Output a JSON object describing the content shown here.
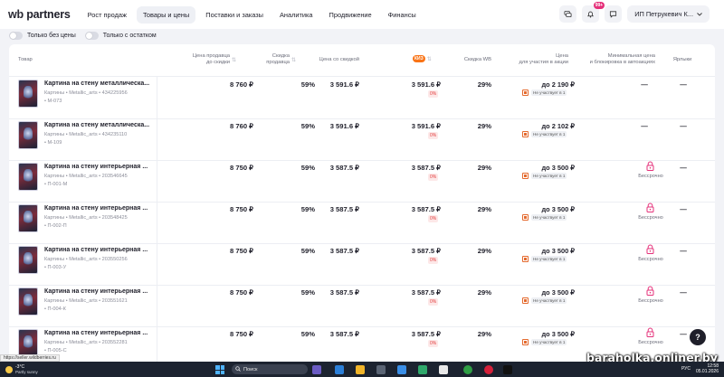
{
  "logo": {
    "wb": "wb",
    "rest": " partners"
  },
  "nav": [
    "Рост продаж",
    "Товары и цены",
    "Поставки и заказы",
    "Аналитика",
    "Продвижение",
    "Финансы"
  ],
  "nav_active": "Товары и цены",
  "notifications_badge": "99+",
  "account_name": "ИП Петрукевич К...",
  "filters": [
    "Только без цены",
    "Только с остатком"
  ],
  "headers": {
    "product": "Товар",
    "price_before_line1": "Цена продавца",
    "price_before_line2": "до скидки",
    "seller_disc_line1": "Скидка",
    "seller_disc_line2": "продавца",
    "price_after": "Цена со скидкой",
    "kiz": "КИЗ",
    "wb_disc": "Скидка WB",
    "promo_line1": "Цена",
    "promo_line2": "для участия в акции",
    "min_line1": "Минимальная цена",
    "min_line2": "и блокировка в автоакциях",
    "labels": "Ярлыки"
  },
  "rows": [
    {
      "name": "Картина на стену металлическа...",
      "meta": "Картины • Metallic_arts • 434225956",
      "sku": "• М-073",
      "price": "8 760 ₽",
      "disc": "59%",
      "after": "3 591.6 ₽",
      "kiz": "3 591.6 ₽",
      "kiz_pct": "0%",
      "wb": "29%",
      "promo": "до 2 190 ₽",
      "promo_note": "Не участвует в 1",
      "ctrl": "—",
      "ctrl_note": "",
      "labels": "—"
    },
    {
      "name": "Картина на стену металлическа...",
      "meta": "Картины • Metallic_arts • 434235110",
      "sku": "• М-109",
      "price": "8 760 ₽",
      "disc": "59%",
      "after": "3 591.6 ₽",
      "kiz": "3 591.6 ₽",
      "kiz_pct": "0%",
      "wb": "29%",
      "promo": "до 2 102 ₽",
      "promo_note": "Не участвует в 1",
      "ctrl": "—",
      "ctrl_note": "",
      "labels": "—"
    },
    {
      "name": "Картина на стену интерьерная ...",
      "meta": "Картины • Metallic_arts • 203546645",
      "sku": "• П-001-М",
      "price": "8 750 ₽",
      "disc": "59%",
      "after": "3 587.5 ₽",
      "kiz": "3 587.5 ₽",
      "kiz_pct": "0%",
      "wb": "29%",
      "promo": "до 3 500 ₽",
      "promo_note": "Не участвует в 1",
      "ctrl": "",
      "ctrl_note": "Бессрочно",
      "labels": "—"
    },
    {
      "name": "Картина на стену интерьерная ...",
      "meta": "Картины • Metallic_arts • 203548425",
      "sku": "• П-002-П",
      "price": "8 750 ₽",
      "disc": "59%",
      "after": "3 587.5 ₽",
      "kiz": "3 587.5 ₽",
      "kiz_pct": "0%",
      "wb": "29%",
      "promo": "до 3 500 ₽",
      "promo_note": "Не участвует в 1",
      "ctrl": "",
      "ctrl_note": "Бессрочно",
      "labels": "—"
    },
    {
      "name": "Картина на стену интерьерная ...",
      "meta": "Картины • Metallic_arts • 203550256",
      "sku": "• П-003-У",
      "price": "8 750 ₽",
      "disc": "59%",
      "after": "3 587.5 ₽",
      "kiz": "3 587.5 ₽",
      "kiz_pct": "0%",
      "wb": "29%",
      "promo": "до 3 500 ₽",
      "promo_note": "Не участвует в 1",
      "ctrl": "",
      "ctrl_note": "Бессрочно",
      "labels": "—"
    },
    {
      "name": "Картина на стену интерьерная ...",
      "meta": "Картины • Metallic_arts • 203551621",
      "sku": "• П-004-К",
      "price": "8 750 ₽",
      "disc": "59%",
      "after": "3 587.5 ₽",
      "kiz": "3 587.5 ₽",
      "kiz_pct": "0%",
      "wb": "29%",
      "promo": "до 3 500 ₽",
      "promo_note": "Не участвует в 1",
      "ctrl": "",
      "ctrl_note": "Бессрочно",
      "labels": "—"
    },
    {
      "name": "Картина на стену интерьерная ...",
      "meta": "Картины • Metallic_arts • 203552281",
      "sku": "• П-005-С",
      "price": "8 750 ₽",
      "disc": "59%",
      "after": "3 587.5 ₽",
      "kiz": "3 587.5 ₽",
      "kiz_pct": "0%",
      "wb": "29%",
      "promo": "до 3 500 ₽",
      "promo_note": "Не участвует в 1",
      "ctrl": "",
      "ctrl_note": "Бессрочно",
      "labels": "—"
    }
  ],
  "help": "?",
  "watermark": "baraholka.onliner.by",
  "status_url": "https://seller.wildberries.ru",
  "taskbar": {
    "weather_temp": "-3°C",
    "weather_desc": "Partly sunny",
    "search": "Поиск",
    "lang": "РУС",
    "time": "12:58",
    "date": "05.01.2026"
  },
  "colors": {
    "accent": "#e5317a",
    "kiz_badge": "#f97316",
    "promo_icon": "#e46a2e",
    "lock": "#e5317a",
    "taskbar": "#1c2330"
  }
}
